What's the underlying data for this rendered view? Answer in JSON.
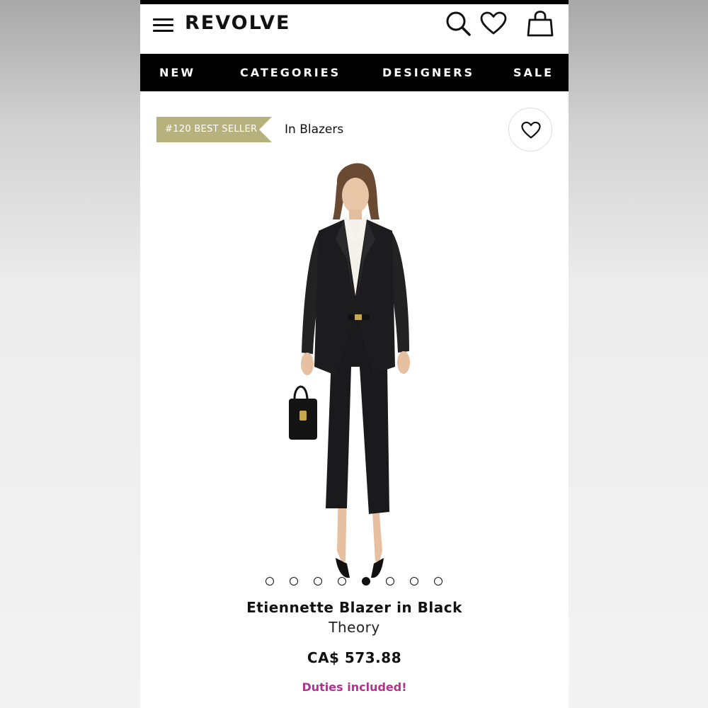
{
  "header": {
    "logo": "REVOLVE",
    "icons": [
      "menu-icon",
      "search-icon",
      "heart-icon",
      "bag-icon"
    ]
  },
  "nav": {
    "items": [
      "NEW",
      "CATEGORIES",
      "DESIGNERS",
      "SALE"
    ]
  },
  "badge": {
    "label": "#120 BEST SELLER",
    "color": "#b7b17d"
  },
  "category": {
    "label": "In Blazers"
  },
  "gallery": {
    "image_count": 8,
    "active_index": 4
  },
  "product": {
    "name": "Etiennette Blazer in Black",
    "brand": "Theory",
    "price": "CA$ 573.88",
    "duties_note": "Duties included!",
    "duties_color": "#b5318f"
  }
}
